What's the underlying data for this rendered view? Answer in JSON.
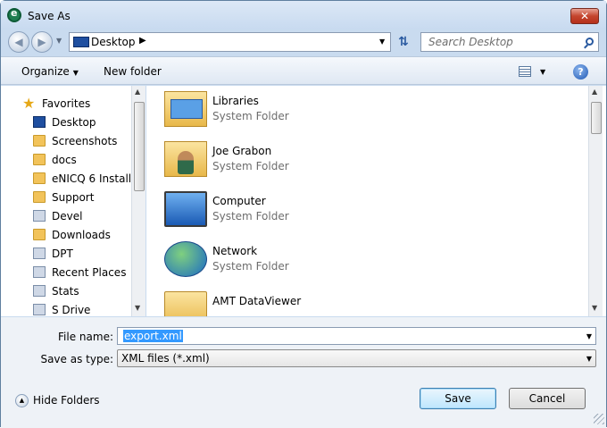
{
  "window": {
    "title": "Save As"
  },
  "nav": {
    "back_icon": "back-arrow-icon",
    "forward_icon": "forward-arrow-icon",
    "address": "Desktop",
    "search_placeholder": "Search Desktop"
  },
  "toolbar": {
    "organize": "Organize",
    "new_folder": "New folder",
    "help": "?"
  },
  "sidebar": {
    "favorites": "Favorites",
    "items": [
      {
        "label": "Desktop",
        "icon": "desktop-icon"
      },
      {
        "label": "Screenshots",
        "icon": "folder-icon"
      },
      {
        "label": "docs",
        "icon": "folder-icon"
      },
      {
        "label": "eNICQ 6 Install",
        "icon": "folder-icon"
      },
      {
        "label": "Support",
        "icon": "folder-icon"
      },
      {
        "label": "Devel",
        "icon": "library-icon"
      },
      {
        "label": "Downloads",
        "icon": "folder-icon"
      },
      {
        "label": "DPT",
        "icon": "library-icon"
      },
      {
        "label": "Recent Places",
        "icon": "recent-places-icon"
      },
      {
        "label": "Stats",
        "icon": "library-icon"
      },
      {
        "label": "S Drive",
        "icon": "network-drive-icon"
      }
    ]
  },
  "files": [
    {
      "name": "Libraries",
      "type": "System Folder",
      "icon": "libraries-icon"
    },
    {
      "name": "Joe Grabon",
      "type": "System Folder",
      "icon": "user-folder-icon"
    },
    {
      "name": "Computer",
      "type": "System Folder",
      "icon": "computer-icon"
    },
    {
      "name": "Network",
      "type": "System Folder",
      "icon": "network-icon"
    },
    {
      "name": "AMT DataViewer",
      "type": "",
      "icon": "folder-icon"
    }
  ],
  "form": {
    "file_name_label": "File name:",
    "file_name_value": "export.xml",
    "save_type_label": "Save as type:",
    "save_type_value": "XML files (*.xml)"
  },
  "footer": {
    "hide_folders": "Hide Folders",
    "save": "Save",
    "cancel": "Cancel"
  }
}
